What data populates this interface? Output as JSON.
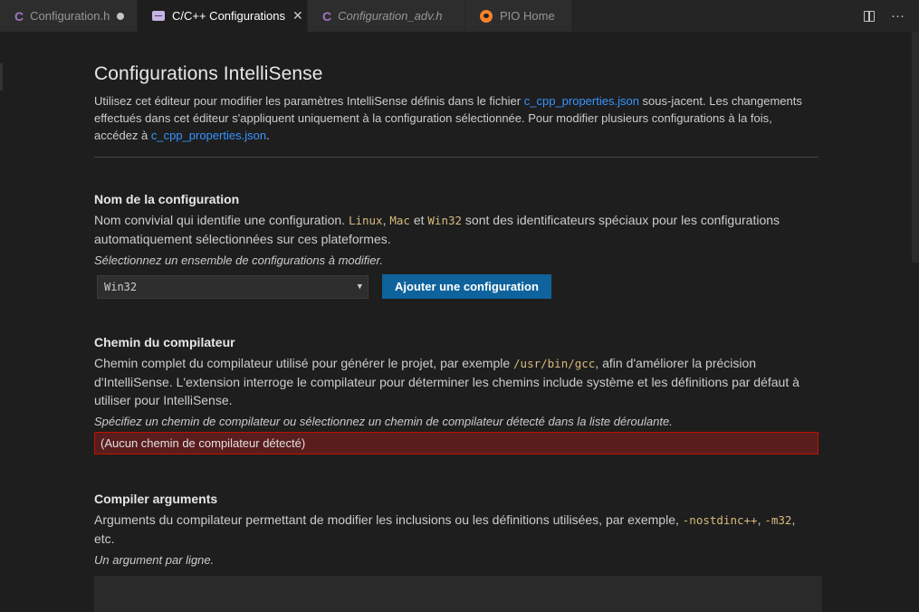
{
  "tabs": [
    {
      "label": "Configuration.h",
      "icon": "c-file-icon",
      "glyph": "C",
      "modified": true
    },
    {
      "label": "C/C++ Configurations",
      "icon": "settings-editor-icon",
      "active": true
    },
    {
      "label": "Configuration_adv.h",
      "icon": "c-file-icon",
      "glyph": "C",
      "italic": true
    },
    {
      "label": "PIO Home",
      "icon": "platformio-icon"
    }
  ],
  "page": {
    "title": "Configurations IntelliSense",
    "desc_1": "Utilisez cet éditeur pour modifier les paramètres IntelliSense définis dans le fichier ",
    "desc_link_1": "c_cpp_properties.json",
    "desc_2": " sous-jacent. Les changements effectués dans cet éditeur s'appliquent uniquement à la configuration sélectionnée. Pour modifier plusieurs configurations à la fois, accédez à ",
    "desc_link_2": "c_cpp_properties.json",
    "desc_3": "."
  },
  "config_name": {
    "title": "Nom de la configuration",
    "desc_1": "Nom convivial qui identifie une configuration. ",
    "code_1": "Linux",
    "sep_1": ", ",
    "code_2": "Mac",
    "sep_2": " et ",
    "code_3": "Win32",
    "desc_2": " sont des identificateurs spéciaux pour les configurations automatiquement sélectionnées sur ces plateformes.",
    "hint": "Sélectionnez un ensemble de configurations à modifier.",
    "selected": "Win32",
    "add_button": "Ajouter une configuration"
  },
  "compiler_path": {
    "title": "Chemin du compilateur",
    "desc_1": "Chemin complet du compilateur utilisé pour générer le projet, par exemple ",
    "code": "/usr/bin/gcc",
    "desc_2": ", afin d'améliorer la précision d'IntelliSense. L'extension interroge le compilateur pour déterminer les chemins include système et les définitions par défaut à utiliser pour IntelliSense.",
    "hint": "Spécifiez un chemin de compilateur ou sélectionnez un chemin de compilateur détecté dans la liste déroulante.",
    "value": "(Aucun chemin de compilateur détecté)"
  },
  "compiler_args": {
    "title": "Compiler arguments",
    "desc_1": "Arguments du compilateur permettant de modifier les inclusions ou les définitions utilisées, par exemple, ",
    "code_1": "-nostdinc++",
    "sep": ", ",
    "code_2": "-m32",
    "desc_2": ", etc.",
    "hint": "Un argument par ligne."
  },
  "colors": {
    "background": "#1e1e1e",
    "accent_button": "#0e639c",
    "link": "#3794ff",
    "code": "#d7ba7d",
    "error_bg": "#5a1d1d",
    "error_border": "#be1100"
  }
}
